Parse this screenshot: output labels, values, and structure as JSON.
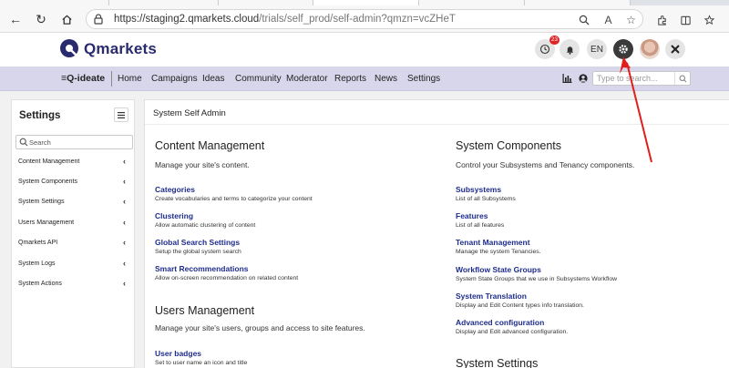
{
  "browser": {
    "url_host": "https://staging2.qmarkets.cloud",
    "url_path": "/trials/self_prod/self-admin?qmzn=vcZHeT"
  },
  "header": {
    "logo_text": "Qmarkets",
    "notification_count": "23",
    "language": "EN"
  },
  "nav": {
    "brand": "Q-ideate",
    "items": [
      "Home",
      "Campaigns",
      "Ideas",
      "Community",
      "Moderator",
      "Reports",
      "News",
      "Settings"
    ],
    "search_placeholder": "Type to search..."
  },
  "sidebar": {
    "title": "Settings",
    "search_placeholder": "Search",
    "items": [
      {
        "label": "Content Management"
      },
      {
        "label": "System Components"
      },
      {
        "label": "System Settings"
      },
      {
        "label": "Users Management"
      },
      {
        "label": "Qmarkets API"
      },
      {
        "label": "System Logs"
      },
      {
        "label": "System Actions"
      }
    ]
  },
  "main": {
    "title": "System Self Admin",
    "left_col": {
      "content_management": {
        "heading": "Content Management",
        "description": "Manage your site's content.",
        "links": [
          {
            "title": "Categories",
            "desc": "Create vocabularies and terms to categorize your content"
          },
          {
            "title": "Clustering",
            "desc": "Allow automatic clustering of content"
          },
          {
            "title": "Global Search Settings",
            "desc": "Setup the global system search"
          },
          {
            "title": "Smart Recommendations",
            "desc": "Allow on-screen recommendation on related content"
          }
        ]
      },
      "users_management": {
        "heading": "Users Management",
        "description": "Manage your site's users, groups and access to site features.",
        "links": [
          {
            "title": "User badges",
            "desc": "Set to user name an icon and title"
          }
        ]
      }
    },
    "right_col": {
      "system_components": {
        "heading": "System Components",
        "description": "Control your Subsystems and Tenancy components.",
        "links": [
          {
            "title": "Subsystems",
            "desc": "List of all Subsystems"
          },
          {
            "title": "Features",
            "desc": "List of all features"
          },
          {
            "title": "Tenant Management",
            "desc": "Manage the system Tenancies."
          },
          {
            "title": "Workflow State Groups",
            "desc": "System State Groups that we use in Subsystems Workflow"
          },
          {
            "title": "System Translation",
            "desc": "Display and Edit Content types info translation."
          },
          {
            "title": "Advanced configuration",
            "desc": "Display and Edit advanced configuration."
          }
        ]
      },
      "system_settings": {
        "heading": "System Settings"
      }
    }
  },
  "colors": {
    "nav_bg": "#d7d6ea",
    "link": "#1e2c8c",
    "logo": "#2a2a6e",
    "annotation_arrow": "#e01e1e",
    "notification_badge": "#e02424"
  }
}
